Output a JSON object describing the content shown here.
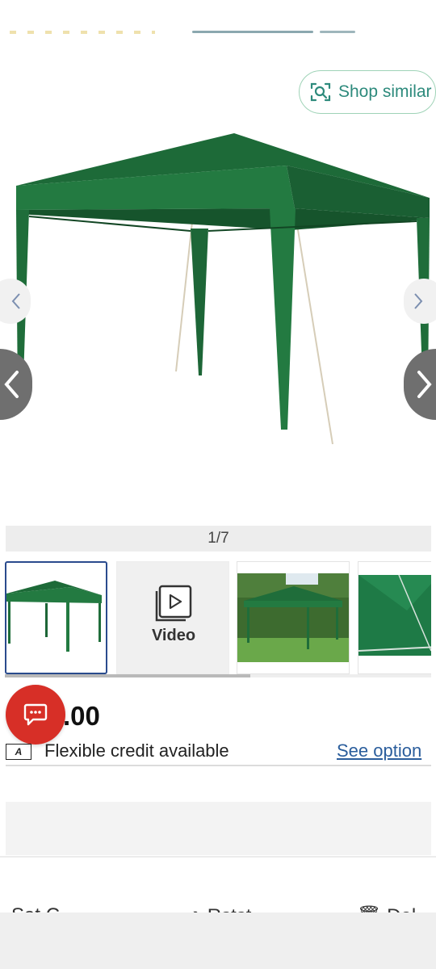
{
  "gallery": {
    "shop_similar_label": "Shop similar",
    "counter": "1/7",
    "thumbnails": [
      {
        "kind": "image",
        "subject": "green gazebo on white"
      },
      {
        "kind": "video",
        "label": "Video"
      },
      {
        "kind": "image",
        "subject": "gazebo on lawn"
      },
      {
        "kind": "image",
        "subject": "gazebo roof detail"
      }
    ],
    "nav_prev_icon": "chevron-left-icon",
    "nav_next_icon": "chevron-right-icon"
  },
  "price": {
    "value_visible": ".00",
    "credit_icon_text": "A",
    "credit_text": "Flexible credit available",
    "see_options": "See option"
  },
  "actions": {
    "save": "Sat C",
    "restore": "Rstst",
    "delete": "Dal"
  },
  "colors": {
    "gazebo_green": "#1f6b3a",
    "accent_teal": "#2d8a7c",
    "chat_red": "#d72f27",
    "link_blue": "#2a5d9c",
    "thumb_selected_border": "#2a4b8d"
  }
}
